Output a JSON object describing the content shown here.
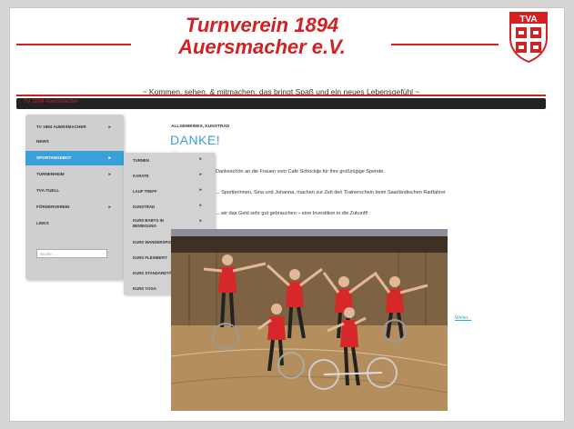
{
  "header": {
    "title_line1": "Turnverein 1894",
    "title_line2": "Auersmacher e.V.",
    "logo_text": "TVA",
    "tagline": "~ Kommen, sehen, & mitmachen, das bringt Spaß und ein neues Lebensgefühl ~",
    "nav_crumb": "TV 1894 Auersmacher"
  },
  "sidebar": {
    "items": [
      {
        "label": "TV 1894 AUERSMACHER",
        "caret": "▸"
      },
      {
        "label": "NEWS",
        "caret": ""
      },
      {
        "label": "SPORTANGEBOT",
        "caret": "▸"
      },
      {
        "label": "TURNERHEIM",
        "caret": "▸"
      },
      {
        "label": "TVA-TUELL",
        "caret": ""
      },
      {
        "label": "FÖRDERVEREIN",
        "caret": "▸"
      },
      {
        "label": "LINKS",
        "caret": ""
      }
    ],
    "search_placeholder": "Suche ..."
  },
  "submenu": {
    "items": [
      {
        "label": "TURNEN",
        "caret": "▸"
      },
      {
        "label": "KARATE",
        "caret": "▸"
      },
      {
        "label": "LAUF TREFF",
        "caret": "▸"
      },
      {
        "label": "KUNSTRAD",
        "caret": "▸"
      },
      {
        "label": "KURS BABYS IN BEWEGUNG",
        "caret": "▸"
      },
      {
        "label": "KURS WANDERSPORT",
        "caret": "▸"
      },
      {
        "label": "KURS FLEXIBEFIT",
        "caret": "▸"
      },
      {
        "label": "KURS STANDARDTÄNZE",
        "caret": "▸"
      },
      {
        "label": "KURS YOGA",
        "caret": "▸"
      }
    ]
  },
  "content": {
    "breadcrumb": "ALLGEMEINES, KUNSTRAD",
    "heading": "DANKE!",
    "meta": "...",
    "paragraph1": "Dankeschön an die Frauen vom Café Schockije für ihre großzügige Spende.",
    "paragraph2": "... Sportlerinnen, Sina und Johanna, machen zur Zeit den Trainerschein beim Saarländischen Radfahrer",
    "paragraph3": "... wir das Geld sehr gut gebrauchen – eine Investition in die Zukunft!",
    "side_link": "Weiter..."
  },
  "colors": {
    "brand_red": "#d42020",
    "accent_blue": "#3aa0d8",
    "navbar_dark": "#222222"
  }
}
